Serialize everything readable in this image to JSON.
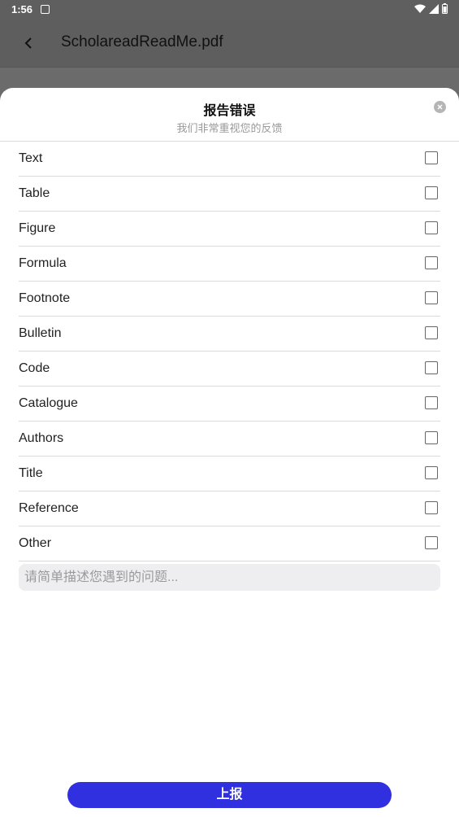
{
  "status_bar": {
    "time": "1:56"
  },
  "app_bar": {
    "title": "ScholareadReadMe.pdf"
  },
  "sheet": {
    "title": "报告错误",
    "subtitle": "我们非常重视您的反馈",
    "options": [
      {
        "label": "Text",
        "checked": false
      },
      {
        "label": "Table",
        "checked": false
      },
      {
        "label": "Figure",
        "checked": false
      },
      {
        "label": "Formula",
        "checked": false
      },
      {
        "label": "Footnote",
        "checked": false
      },
      {
        "label": "Bulletin",
        "checked": false
      },
      {
        "label": "Code",
        "checked": false
      },
      {
        "label": "Catalogue",
        "checked": false
      },
      {
        "label": "Authors",
        "checked": false
      },
      {
        "label": "Title",
        "checked": false
      },
      {
        "label": "Reference",
        "checked": false
      },
      {
        "label": "Other",
        "checked": false
      }
    ],
    "description": {
      "placeholder": "请简单描述您遇到的问题...",
      "value": ""
    },
    "submit_label": "上报"
  },
  "colors": {
    "accent": "#3030e0",
    "scrim": "#6b6b6b"
  }
}
